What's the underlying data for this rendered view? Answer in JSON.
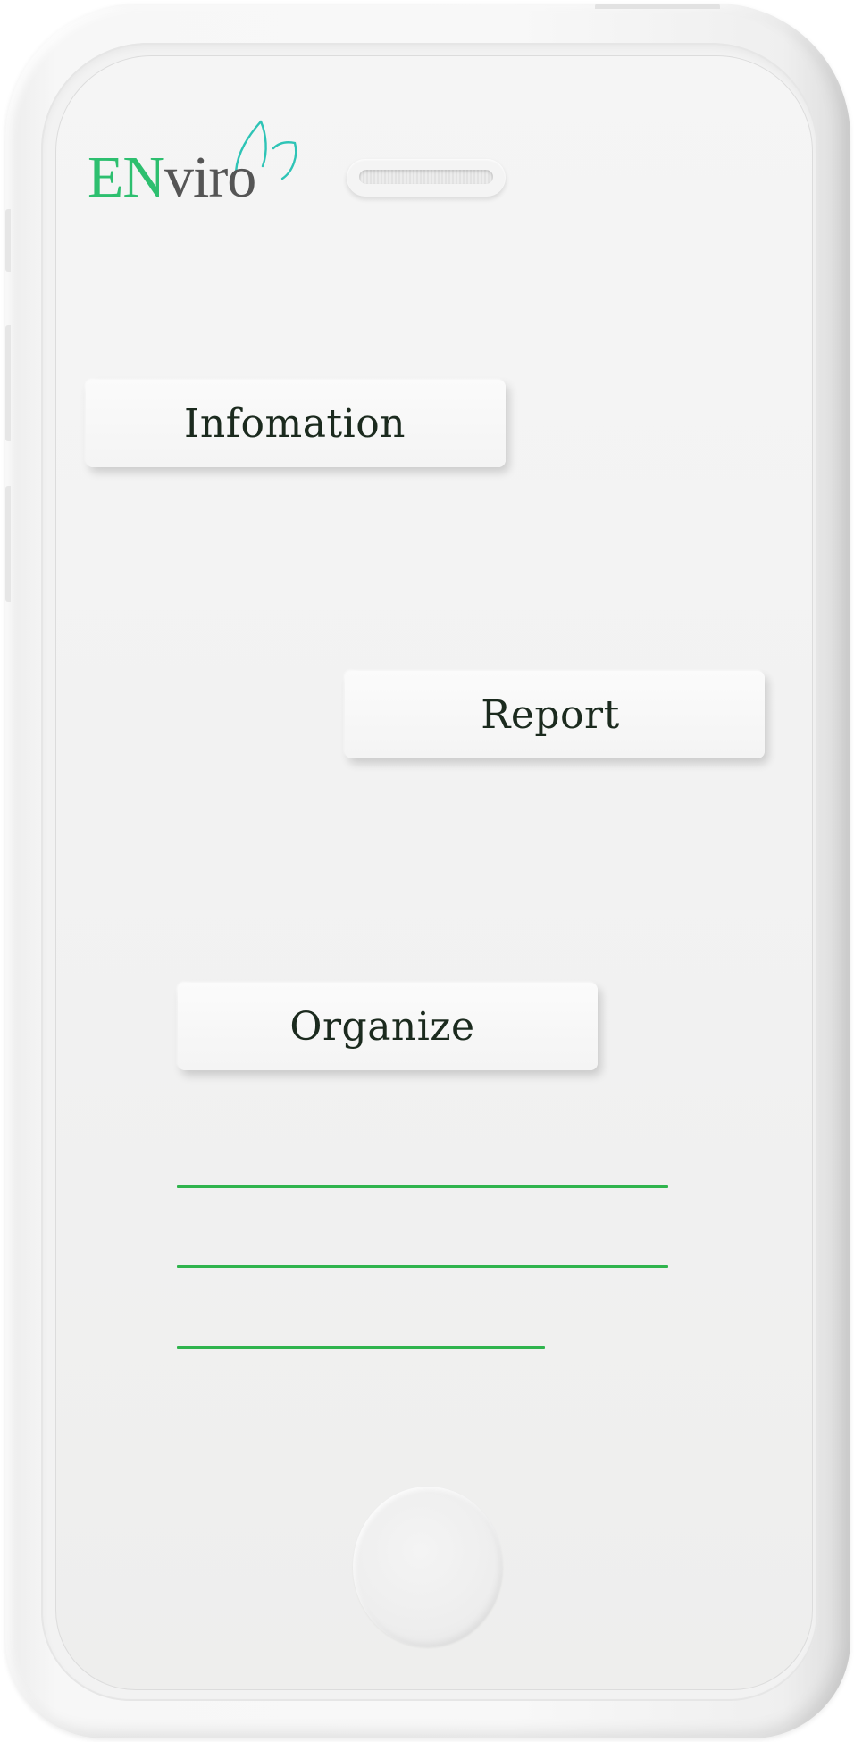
{
  "app": {
    "logo": {
      "part1": "EN",
      "part2": "viro",
      "icon": "leaf-drops-icon"
    }
  },
  "menu": {
    "items": [
      {
        "label": "Infomation"
      },
      {
        "label": "Report"
      },
      {
        "label": "Organize"
      }
    ]
  },
  "placeholder_lines": 3,
  "device": {
    "speaker": "speaker-grill",
    "home_button": "home-button"
  },
  "colors": {
    "brand_green": "#2dbf6f",
    "logo_gray": "#555555",
    "leaf_teal": "#2ec4b6",
    "line_green": "#2fb44d",
    "button_text": "#1b2a1e"
  }
}
